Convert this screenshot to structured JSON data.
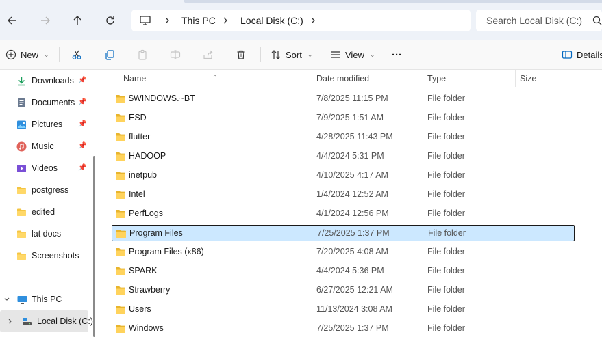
{
  "address": {
    "crumbs": [
      "This PC",
      "Local Disk (C:)"
    ],
    "search_placeholder": "Search Local Disk (C:)"
  },
  "toolbar": {
    "new_label": "New",
    "sort_label": "Sort",
    "view_label": "View",
    "more_label": "···",
    "details_label": "Details"
  },
  "nav": {
    "quick": [
      {
        "label": "Downloads",
        "icon": "download-icon",
        "pinned": true
      },
      {
        "label": "Documents",
        "icon": "document-icon",
        "pinned": true
      },
      {
        "label": "Pictures",
        "icon": "pictures-icon",
        "pinned": true
      },
      {
        "label": "Music",
        "icon": "music-icon",
        "pinned": true
      },
      {
        "label": "Videos",
        "icon": "videos-icon",
        "pinned": true
      },
      {
        "label": "postgress",
        "icon": "folder-icon",
        "pinned": false
      },
      {
        "label": "edited",
        "icon": "folder-icon",
        "pinned": false
      },
      {
        "label": "lat docs",
        "icon": "folder-icon",
        "pinned": false
      },
      {
        "label": "Screenshots",
        "icon": "folder-icon",
        "pinned": false
      }
    ],
    "this_pc": "This PC",
    "local_disk": "Local Disk (C:)"
  },
  "columns": {
    "name": "Name",
    "date": "Date modified",
    "type": "Type",
    "size": "Size"
  },
  "files": [
    {
      "name": "$WINDOWS.~BT",
      "date": "7/8/2025 11:15 PM",
      "type": "File folder",
      "selected": false
    },
    {
      "name": "ESD",
      "date": "7/9/2025 1:51 AM",
      "type": "File folder",
      "selected": false
    },
    {
      "name": "flutter",
      "date": "4/28/2025 11:43 PM",
      "type": "File folder",
      "selected": false
    },
    {
      "name": "HADOOP",
      "date": "4/4/2024 5:31 PM",
      "type": "File folder",
      "selected": false
    },
    {
      "name": "inetpub",
      "date": "4/10/2025 4:17 AM",
      "type": "File folder",
      "selected": false
    },
    {
      "name": "Intel",
      "date": "1/4/2024 12:52 AM",
      "type": "File folder",
      "selected": false
    },
    {
      "name": "PerfLogs",
      "date": "4/1/2024 12:56 PM",
      "type": "File folder",
      "selected": false
    },
    {
      "name": "Program Files",
      "date": "7/25/2025 1:37 PM",
      "type": "File folder",
      "selected": true
    },
    {
      "name": "Program Files (x86)",
      "date": "7/20/2025 4:08 AM",
      "type": "File folder",
      "selected": false
    },
    {
      "name": "SPARK",
      "date": "4/4/2024 5:36 PM",
      "type": "File folder",
      "selected": false
    },
    {
      "name": "Strawberry",
      "date": "6/27/2025 12:21 AM",
      "type": "File folder",
      "selected": false
    },
    {
      "name": "Users",
      "date": "11/13/2024 3:08 AM",
      "type": "File folder",
      "selected": false
    },
    {
      "name": "Windows",
      "date": "7/25/2025 1:37 PM",
      "type": "File folder",
      "selected": false
    }
  ],
  "colors": {
    "folder": "#f4c542",
    "accent": "#0067c0",
    "selection": "#cce8ff"
  }
}
